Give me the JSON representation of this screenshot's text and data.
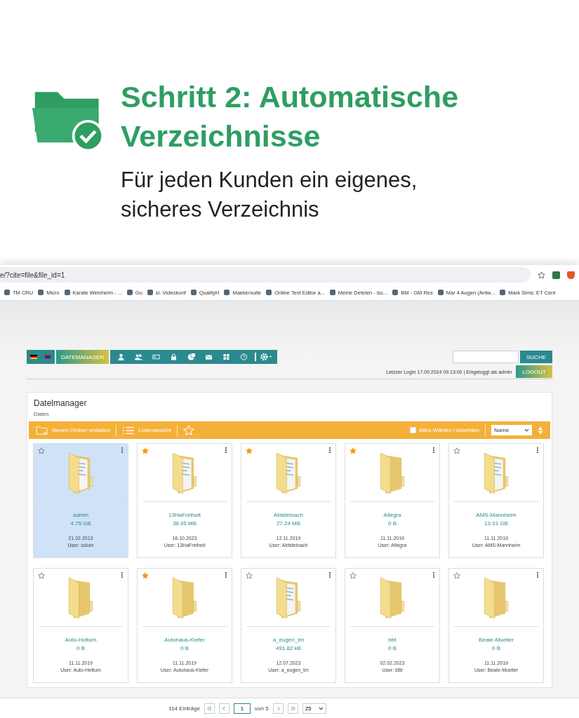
{
  "headline": {
    "title": "Schritt 2: Automatische Verzeichnisse",
    "subtitle": "Für jeden Kunden ein eigenes, sicheres Verzeichnis"
  },
  "browser": {
    "url": "e/?cite=file&file_id=1",
    "bookmarks": [
      "TM CRU",
      "Micro",
      "Karate Weinheim - ...",
      "Gu",
      "si. Videokonf",
      "QualityH",
      "Maekersuite",
      "Online Text Editor a...",
      "Meine Deteien - isc...",
      "BM - GM Res",
      "Mar 4 Augen (Antw...",
      "Mark Sims: ET Cent"
    ]
  },
  "nav": {
    "active_tab": {
      "label": "DATEMANAGER",
      "selected": true
    },
    "search_button": "SUCHE",
    "login_info": "Letzzer Login 17.09 2024 09.13:00 | Eingeloggt als admin",
    "logout_button": "LOGOUT"
  },
  "panel": {
    "title": "Datelmanager",
    "breadcrumb": "Daten"
  },
  "toolbar": {
    "new_folder": "Neuen Ordner erstallen",
    "list_view": "Listenansicht",
    "select_all": {
      "label": "Alles Wählen / Abwihten",
      "checked": false
    },
    "sort": "Name"
  },
  "folders": [
    {
      "name": "admin",
      "size": "4.75 GB",
      "date": "21.02.2013",
      "user": "User: sdioin",
      "starred": false,
      "selected": true,
      "kind": "papers"
    },
    {
      "name": "13HaFrelhelt",
      "size": "38.95 MB",
      "date": "16.10.2023",
      "user": "User: 13HaFrelheit",
      "starred": true,
      "selected": false,
      "kind": "papers"
    },
    {
      "name": "Abtsteinach",
      "size": "27.24 MB",
      "date": "12.11.2019",
      "user": "User: Abtsteinach",
      "starred": true,
      "selected": false,
      "kind": "papers"
    },
    {
      "name": "Allegra",
      "size": "0 B",
      "date": "11.11.2019",
      "user": "User: Afiegra",
      "starred": true,
      "selected": false,
      "kind": "empty"
    },
    {
      "name": "AMS-Mannheim",
      "size": "13.01 GB",
      "date": "11.11.2019",
      "user": "User: AMS-Mannheim",
      "starred": false,
      "selected": false,
      "kind": "papers"
    },
    {
      "name": "Auto-Hottum",
      "size": "0 B",
      "date": "11.11.2019",
      "user": "User: Auto-Hettum",
      "starred": false,
      "selected": false,
      "kind": "empty"
    },
    {
      "name": "Autohaus-Kiefer",
      "size": "0 B",
      "date": "11.11.2019",
      "user": "User: Autohaus-Kiefer",
      "starred": true,
      "selected": false,
      "kind": "empty"
    },
    {
      "name": "a_eugen_tm",
      "size": "491.82 kB",
      "date": "12.07.2023",
      "user": "User: a_eugen_tm",
      "starred": false,
      "selected": false,
      "kind": "papers"
    },
    {
      "name": "bbt",
      "size": "0 B",
      "date": "02.02.2023",
      "user": "User: 6Bt",
      "starred": false,
      "selected": false,
      "kind": "empty"
    },
    {
      "name": "Beate-Mueller",
      "size": "0 B",
      "date": "11.11.2019",
      "user": "User: Beate-Mueller",
      "starred": false,
      "selected": false,
      "kind": "empty"
    }
  ],
  "pagination": {
    "count": "114 Einträge",
    "page": "1",
    "of": "von 5",
    "per_page": "25"
  }
}
